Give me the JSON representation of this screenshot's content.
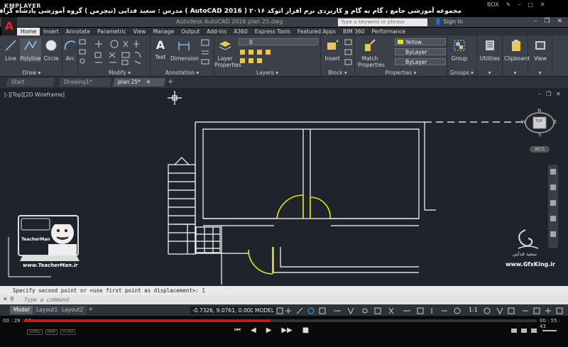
{
  "player": {
    "app_name": "KMPLAYER",
    "video_title": "مجموعه آموزشی جامع ، گام به گام و کاربردی نرم افزار  اتوکد ۲۰۱۶ ( AutoCAD  2016 )  مدرس : سعید فدایی (تیچرمن ) گروه آموزشی پادشاه گرافیست ها",
    "box_label": "BOX",
    "current_time": "00 : 28 : 13",
    "total_time": "00 : 55 : 43",
    "progress": 0.48,
    "tags": [
      "1080p",
      "RAW",
      "H.264"
    ]
  },
  "app": {
    "logo": "A",
    "document_title": "Autodesk AutoCAD 2016    plan 25.dwg",
    "search_placeholder": "Type a keyword or phrase",
    "signin": "Sign In"
  },
  "ribbon_tabs": [
    "Home",
    "Insert",
    "Annotate",
    "Parametric",
    "View",
    "Manage",
    "Output",
    "Add-ins",
    "A360",
    "Express Tools",
    "Featured Apps",
    "BIM 360",
    "Performance"
  ],
  "panels": {
    "draw": {
      "label": "Draw",
      "buttons": [
        "Line",
        "Polyline",
        "Circle",
        "Arc"
      ]
    },
    "modify": {
      "label": "Modify"
    },
    "annotation": {
      "label": "Annotation",
      "buttons": [
        "Text",
        "Dimension"
      ]
    },
    "layers": {
      "label": "Layers",
      "properties_btn": "Layer Properties",
      "current_layer": "0"
    },
    "block": {
      "label": "Block",
      "insert_btn": "Insert"
    },
    "properties": {
      "label": "Properties",
      "match_btn": "Match Properties",
      "color": "Yellow",
      "linetype": "ByLayer",
      "lineweight": "ByLayer"
    },
    "groups": {
      "label": "Groups",
      "group_btn": "Group"
    },
    "utilities": {
      "label": "Utilities"
    },
    "clipboard": {
      "label": "Clipboard"
    },
    "view": {
      "label": "View"
    }
  },
  "file_tabs": [
    "Start",
    "Drawing1*",
    "plan 25*"
  ],
  "viewport": {
    "label": "[-][Top][2D Wireframe]",
    "viewcube_top": "TOP",
    "compass": {
      "n": "N",
      "s": "S",
      "e": "E",
      "w": "W"
    },
    "wcs": "WCS"
  },
  "watermark": {
    "site": "www.TeacherMan.ir",
    "logo_text": "TeacherMan",
    "site2": "www.GfxKing.ir",
    "site2_name": "سعید فدایی"
  },
  "command": {
    "history": "Specify second point or <use first point as displacement>: 1",
    "placeholder": "Type a command"
  },
  "layout_tabs": [
    "Model",
    "Layout1",
    "Layout2"
  ],
  "status": {
    "coordinates": "-0.7326, 9.0761, 0.0000",
    "model": "MODEL",
    "scale": "1:1"
  },
  "colors": {
    "accent_red": "#e02424",
    "canvas": "#1f232b",
    "selection": "#e6e600",
    "linework": "#ffffff"
  }
}
